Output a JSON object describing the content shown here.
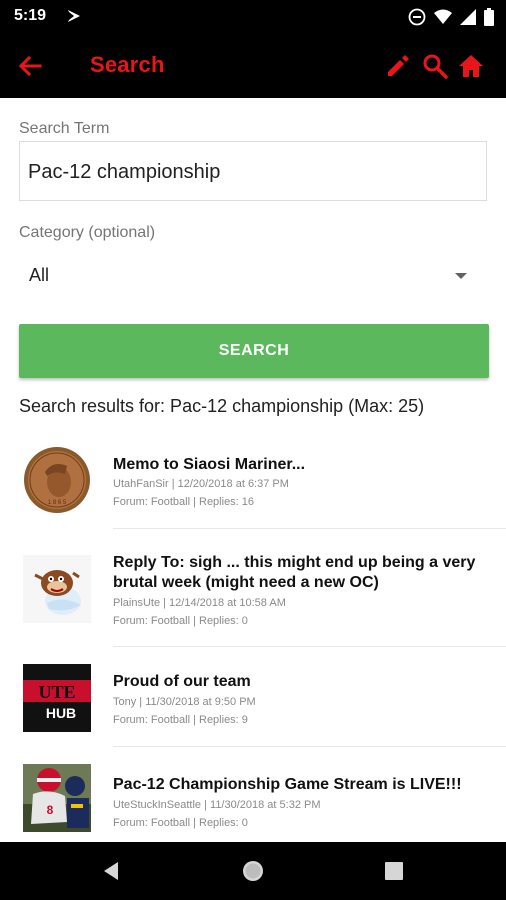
{
  "status_bar": {
    "time": "5:19",
    "left_icon": "flag-icon",
    "right_icons": [
      "do-not-disturb-icon",
      "wifi-icon",
      "signal-icon",
      "battery-icon"
    ]
  },
  "app_bar": {
    "title": "Search",
    "accent_color": "#e8151b",
    "background_color": "#000000",
    "actions": [
      "edit-icon",
      "search-icon",
      "home-icon"
    ]
  },
  "form": {
    "search_term_label": "Search Term",
    "search_term_value": "Pac-12 championship",
    "category_label": "Category (optional)",
    "category_value": "All",
    "search_button_label": "SEARCH",
    "button_color": "#5cb85c"
  },
  "results_heading": "Search results for: Pac-12 championship (Max: 25)",
  "results": [
    {
      "title": "Memo to Siaosi Mariner...",
      "byline": "UtahFanSir | 12/20/2018 at 6:37 PM",
      "forum": "Forum: Football | Replies: 16",
      "thumb": "penny-coin-avatar"
    },
    {
      "title": "Reply To: sigh ... this might end up being a very brutal week (might need a new OC)",
      "byline": "PlainsUte | 12/14/2018 at 10:58 AM",
      "forum": "Forum: Football | Replies: 0",
      "thumb": "cartoon-avatar"
    },
    {
      "title": "Proud of our team",
      "byline": "Tony | 11/30/2018 at 9:50 PM",
      "forum": "Forum: Football | Replies: 9",
      "thumb": "ute-hub-logo-avatar",
      "thumb_text": "UTE HUB"
    },
    {
      "title": "Pac-12 Championship Game Stream is LIVE!!!",
      "byline": "UteStuckInSeattle | 11/30/2018 at 5:32 PM",
      "forum": "Forum: Football | Replies: 0",
      "thumb": "football-photo-avatar"
    }
  ],
  "nav_bar": [
    "back-triangle-icon",
    "home-circle-icon",
    "recents-square-icon"
  ]
}
